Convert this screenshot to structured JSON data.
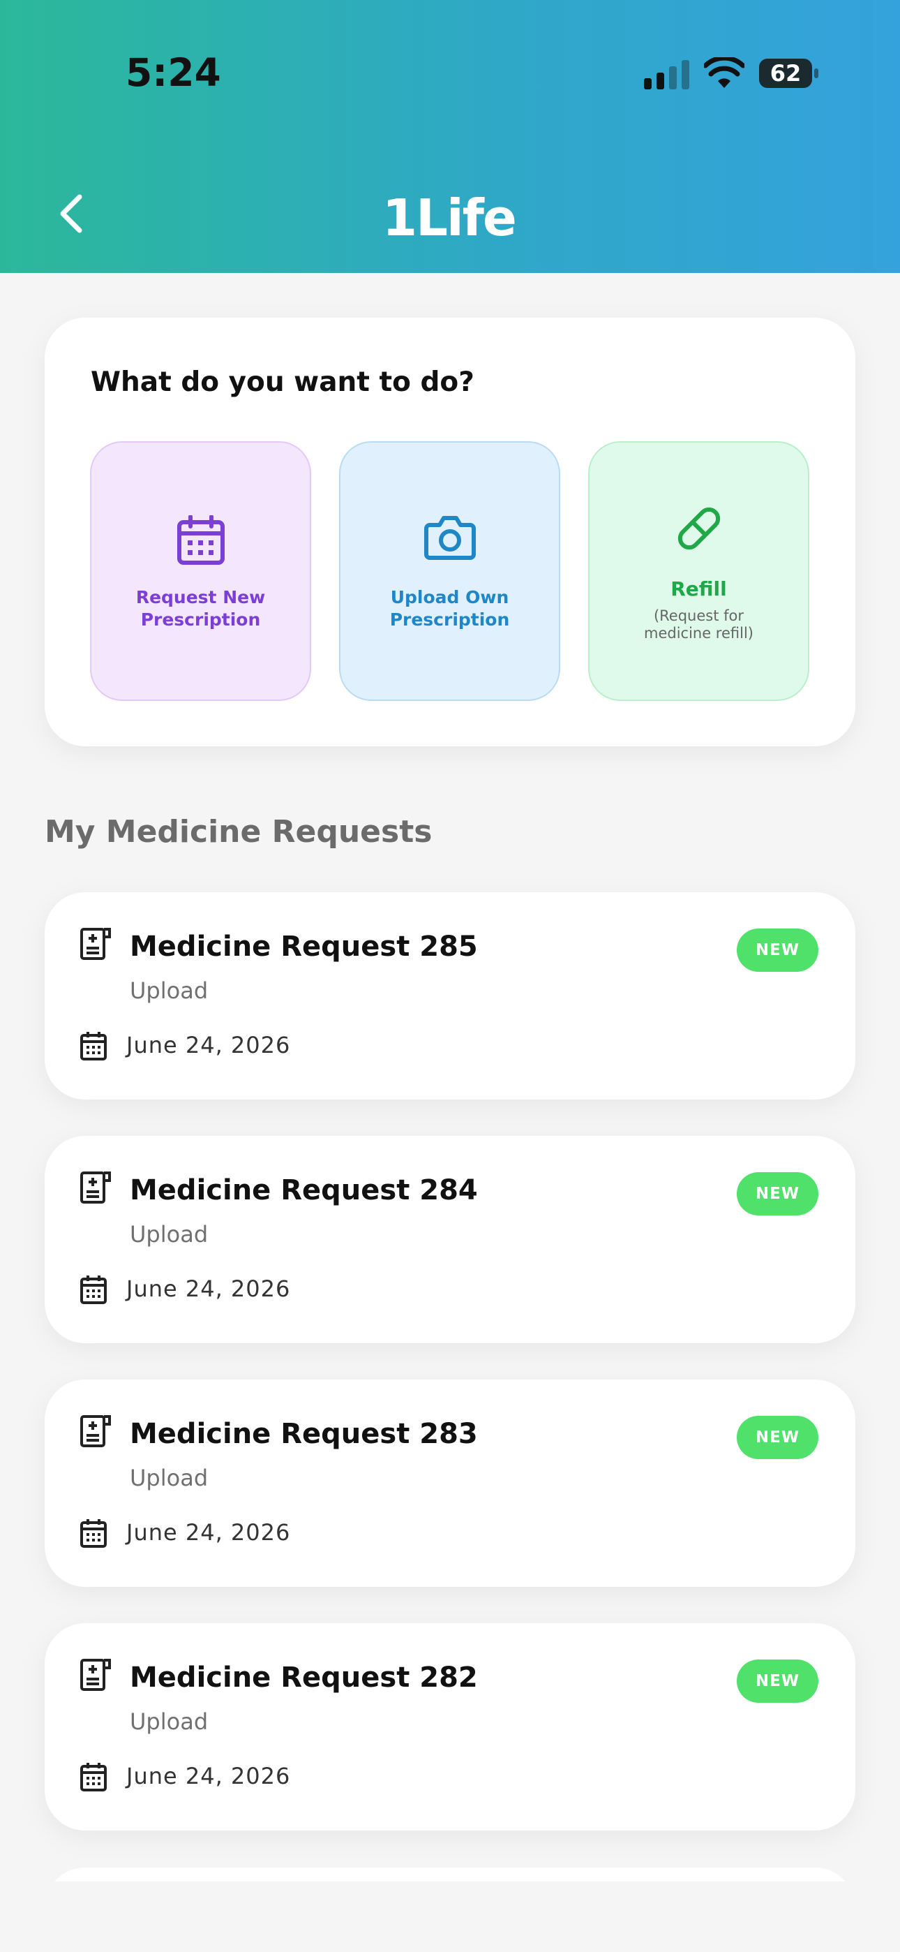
{
  "status_bar": {
    "time": "5:24",
    "battery": "62"
  },
  "header": {
    "logo": "1Life",
    "back_icon": "chevron-left-icon"
  },
  "actions": {
    "title": "What do you want to do?",
    "tiles": [
      {
        "label": "Request New Prescription",
        "icon": "calendar-icon",
        "color": "#7b3fd6"
      },
      {
        "label": "Upload Own Prescription",
        "icon": "camera-icon",
        "color": "#1f86c8"
      },
      {
        "label": "Refill",
        "sublabel": "(Request for medicine refill)",
        "icon": "pill-icon",
        "color": "#1fa847"
      }
    ]
  },
  "requests": {
    "title": "My Medicine Requests",
    "items": [
      {
        "title": "Medicine Request 285",
        "type": "Upload",
        "date": "June 24, 2026",
        "status": "NEW"
      },
      {
        "title": "Medicine Request 284",
        "type": "Upload",
        "date": "June 24, 2026",
        "status": "NEW"
      },
      {
        "title": "Medicine Request 283",
        "type": "Upload",
        "date": "June 24, 2026",
        "status": "NEW"
      },
      {
        "title": "Medicine Request 282",
        "type": "Upload",
        "date": "June 24, 2026",
        "status": "NEW"
      }
    ]
  },
  "colors": {
    "header_start": "#2bb89a",
    "header_end": "#34a2dc",
    "badge": "#4fe16a"
  }
}
